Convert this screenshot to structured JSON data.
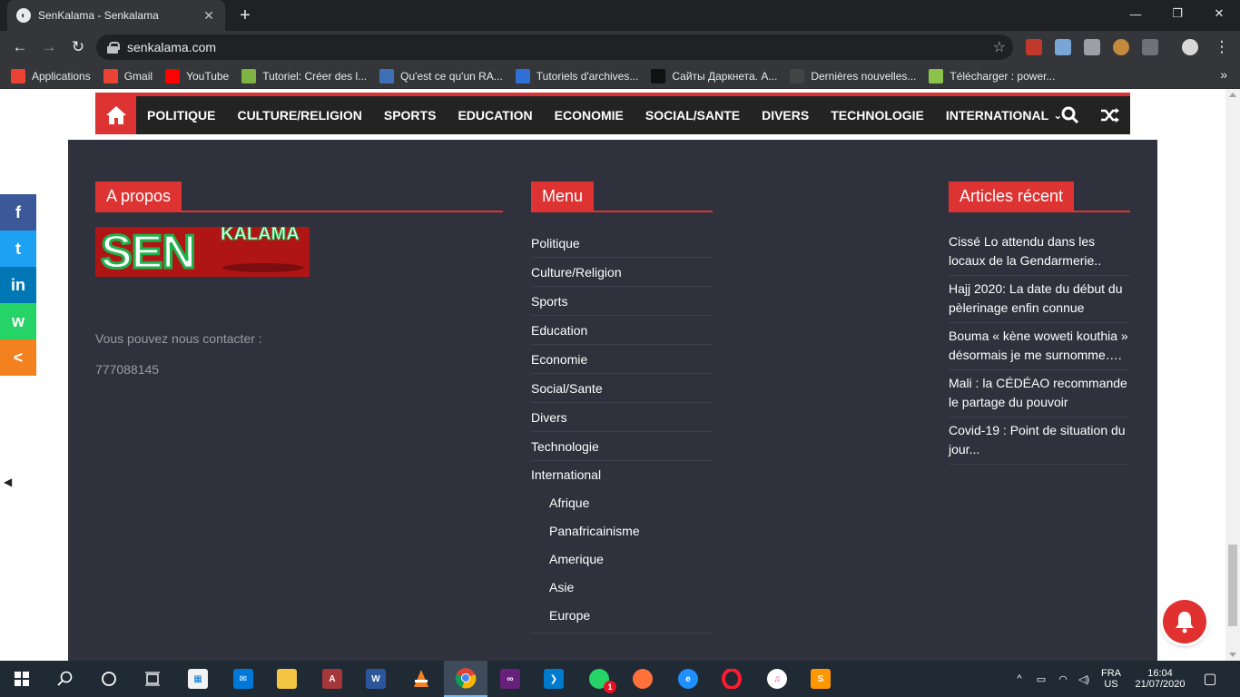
{
  "browser": {
    "tab_title": "SenKalama - Senkalama",
    "tab_close": "✕",
    "new_tab": "+",
    "url": "senkalama.com",
    "bookmarks": [
      {
        "label": "Applications",
        "icon": "apps-grid-icon",
        "color": "#ea4335"
      },
      {
        "label": "Gmail",
        "icon": "gmail-icon",
        "color": "#ea4335"
      },
      {
        "label": "YouTube",
        "icon": "youtube-icon",
        "color": "#ff0000"
      },
      {
        "label": "Tutoriel: Créer des l...",
        "icon": "android-icon",
        "color": "#7cb342"
      },
      {
        "label": "Qu'est ce qu'un RA...",
        "icon": "page-icon",
        "color": "#3f6fb5"
      },
      {
        "label": "Tutoriels d'archives...",
        "icon": "cl-icon",
        "color": "#2f6fd6"
      },
      {
        "label": "Сайты Даркнета. А...",
        "icon": "k-icon",
        "color": "#111111"
      },
      {
        "label": "Dernières nouvelles...",
        "icon": "anonymous-icon",
        "color": "#444444"
      },
      {
        "label": "Télécharger : power...",
        "icon": "ld-icon",
        "color": "#8bc34a"
      }
    ],
    "bookmarks_more": "»"
  },
  "site": {
    "accent": "#dd3333",
    "nav": [
      "POLITIQUE",
      "CULTURE/RELIGION",
      "SPORTS",
      "EDUCATION",
      "ECONOMIE",
      "SOCIAL/SANTE",
      "DIVERS",
      "TECHNOLOGIE",
      "INTERNATIONAL"
    ],
    "nav_dropdown_caret": "⌄",
    "about": {
      "title": "A propos",
      "logo_main": "SEN",
      "logo_sub": "KALAMA",
      "contact_label": "Vous pouvez nous contacter :",
      "phone": "777088145"
    },
    "menu": {
      "title": "Menu",
      "items": [
        "Politique",
        "Culture/Religion",
        "Sports",
        "Education",
        "Economie",
        "Social/Sante",
        "Divers",
        "Technologie"
      ],
      "international": "International",
      "subitems": [
        "Afrique",
        "Panafricainisme",
        "Amerique",
        "Asie",
        "Europe"
      ]
    },
    "articles": {
      "title": "Articles récent",
      "items": [
        "Cissé Lo attendu dans les locaux de la Gendarmerie..",
        "Hajj 2020: La date du début du pèlerinage enfin connue",
        "Bouma « kène woweti kouthia » désormais je me surnomme….",
        "Mali : la CÉDÉAO recommande le partage du pouvoir",
        "Covid-19 : Point de situation du jour..."
      ]
    },
    "share": [
      {
        "label": "f",
        "icon": "facebook-icon",
        "color": "#3b5998"
      },
      {
        "label": "t",
        "icon": "twitter-icon",
        "color": "#1da1f2"
      },
      {
        "label": "in",
        "icon": "linkedin-icon",
        "color": "#0077b5"
      },
      {
        "label": "w",
        "icon": "whatsapp-icon",
        "color": "#25d366"
      },
      {
        "label": "<",
        "icon": "share-icon",
        "color": "#f48120"
      }
    ]
  },
  "taskbar": {
    "lang_top": "FRA",
    "lang_bottom": "US",
    "time": "16:04",
    "date": "21/07/2020",
    "whatsapp_badge": "1"
  }
}
